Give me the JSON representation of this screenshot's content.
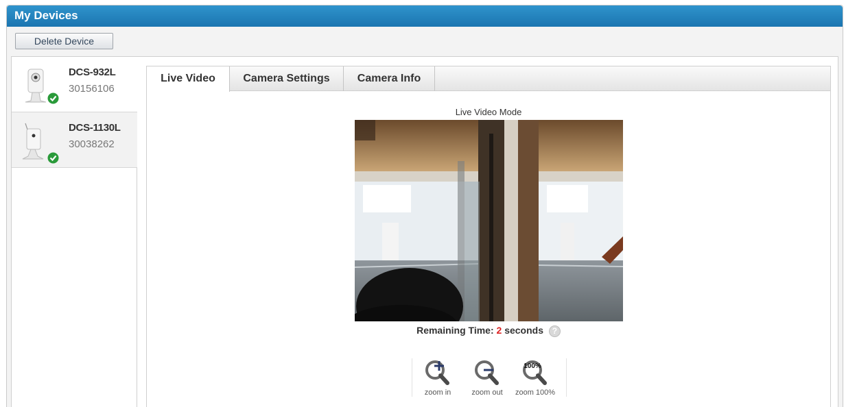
{
  "window": {
    "title": "My Devices"
  },
  "toolbar": {
    "delete_label": "Delete Device"
  },
  "devices": [
    {
      "name": "DCS-932L",
      "serial": "30156106",
      "status": "online"
    },
    {
      "name": "DCS-1130L",
      "serial": "30038262",
      "status": "online"
    }
  ],
  "tabs": [
    {
      "label": "Live Video",
      "active": true
    },
    {
      "label": "Camera Settings",
      "active": false
    },
    {
      "label": "Camera Info",
      "active": false
    }
  ],
  "live": {
    "mode_label": "Live Video Mode",
    "remaining_prefix": "Remaining Time:",
    "remaining_value": "2",
    "remaining_suffix": "seconds",
    "help_glyph": "?"
  },
  "zoom": {
    "in_label": "zoom in",
    "out_label": "zoom out",
    "full_label": "zoom 100%",
    "full_glyph": "100%"
  },
  "colors": {
    "titlebar": "#1b75b0",
    "online": "#2a9a3a",
    "remaining_number": "#dd2222"
  },
  "icons": [
    "camera-icon",
    "check-icon",
    "help-icon",
    "zoom-in-icon",
    "zoom-out-icon",
    "zoom-100-icon"
  ]
}
